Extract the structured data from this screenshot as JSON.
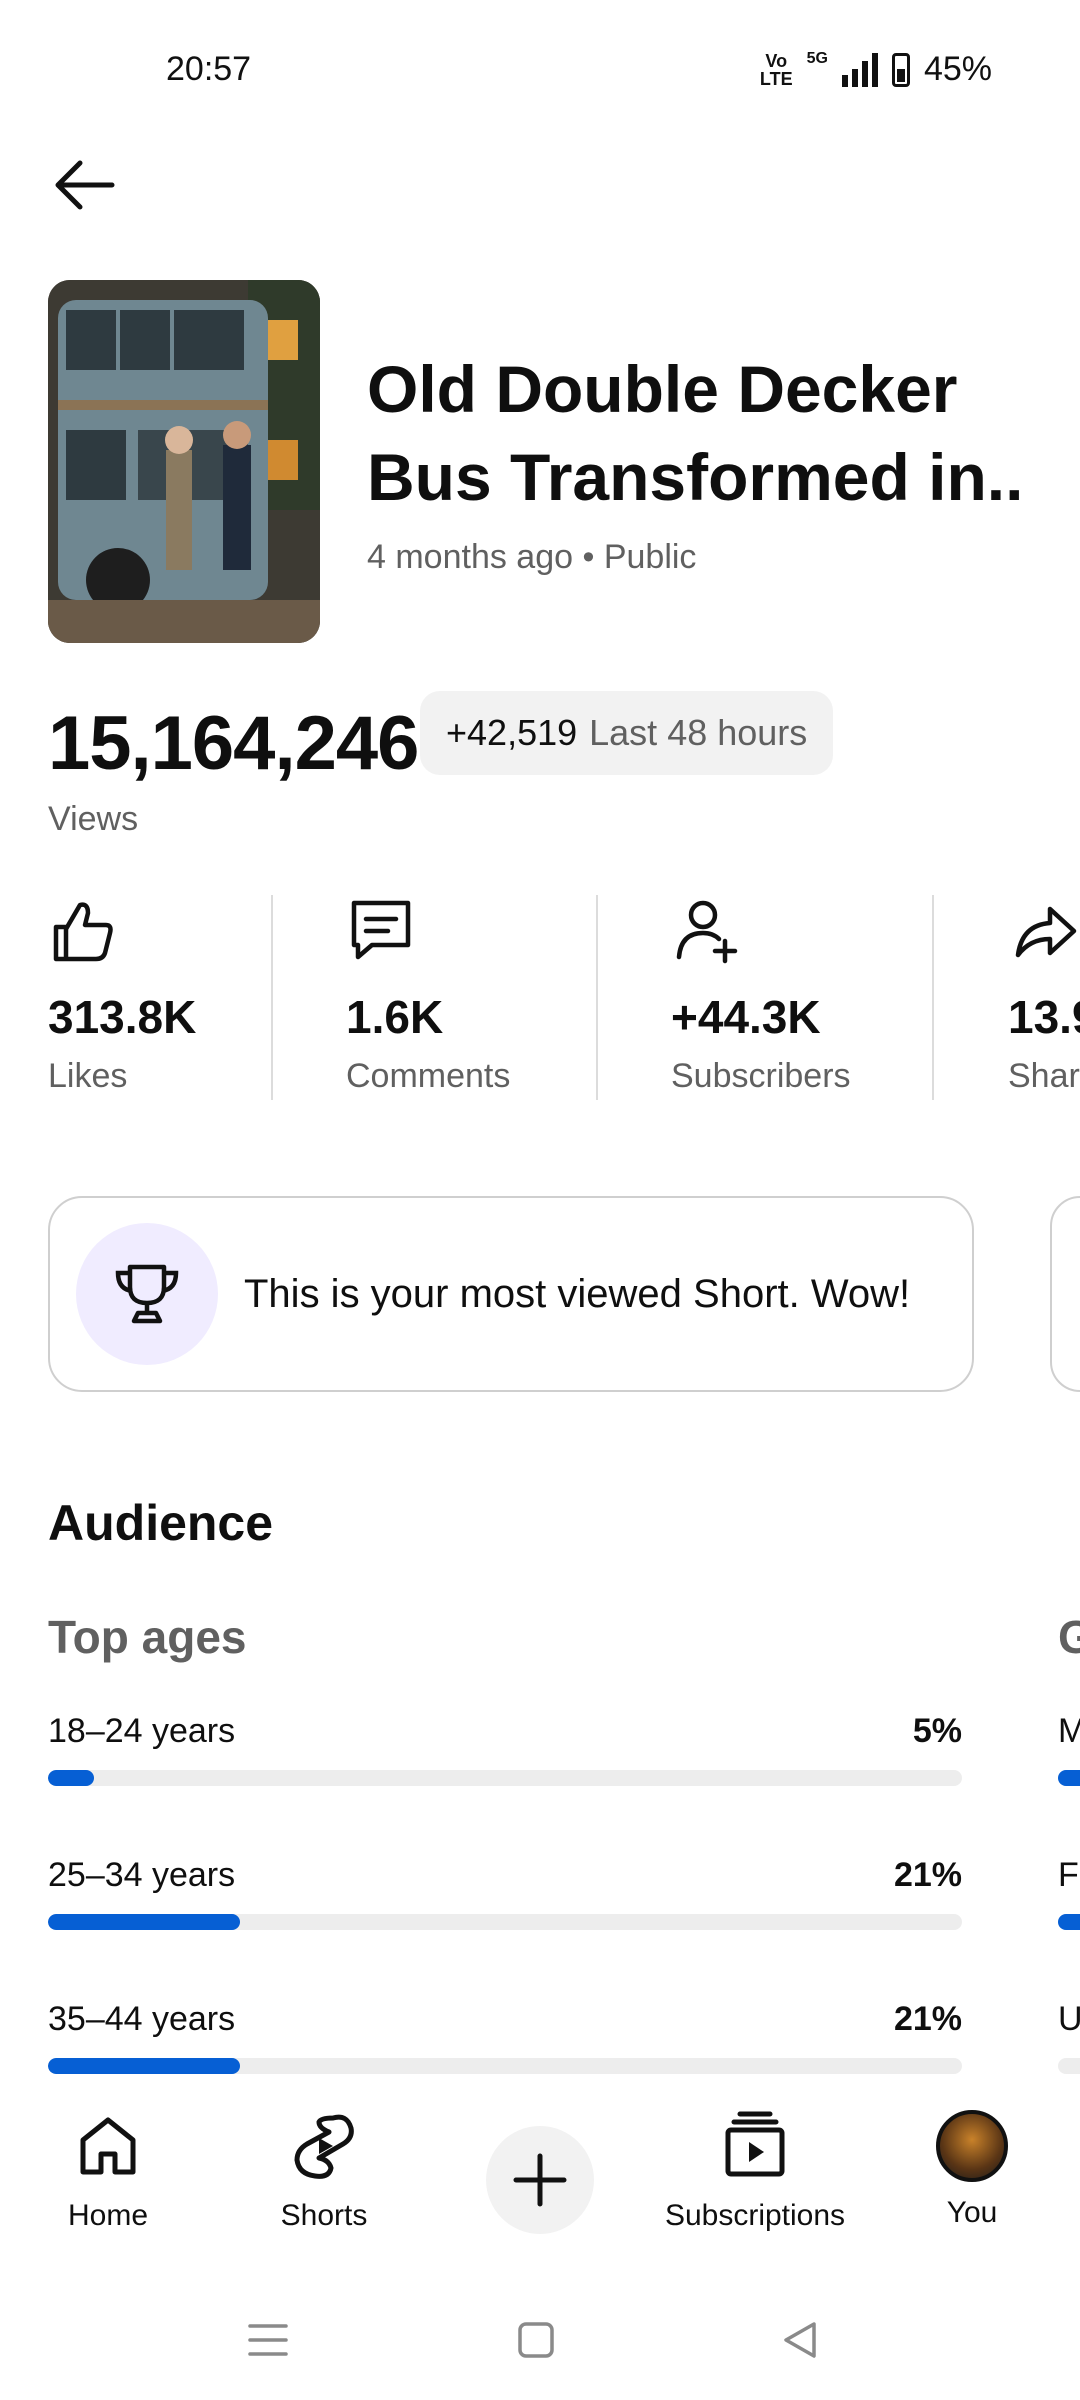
{
  "status": {
    "time": "20:57",
    "volte": "Vo LTE",
    "network": "5G",
    "battery": "45%"
  },
  "video": {
    "title": "Old Double Decker Bus Transformed in..",
    "meta": "4 months ago • Public"
  },
  "views": {
    "count": "15,164,246",
    "delta": "+42,519",
    "period": "Last 48 hours",
    "label": "Views"
  },
  "metrics": [
    {
      "value": "313.8K",
      "label": "Likes",
      "icon": "thumb-up-icon"
    },
    {
      "value": "1.6K",
      "label": "Comments",
      "icon": "comment-icon"
    },
    {
      "value": "+44.3K",
      "label": "Subscribers",
      "icon": "person-add-icon"
    },
    {
      "value": "13.9",
      "label": "Shar",
      "icon": "share-icon"
    }
  ],
  "highlight": {
    "text": "This is your most viewed Short. Wow!",
    "icon": "trophy-icon"
  },
  "audience": {
    "heading": "Audience",
    "top_ages_label": "Top ages",
    "peek_heading": "G",
    "ages": [
      {
        "label": "18–24 years",
        "pct": "5%",
        "fill": 0.05
      },
      {
        "label": "25–34 years",
        "pct": "21%",
        "fill": 0.21
      },
      {
        "label": "35–44 years",
        "pct": "21%",
        "fill": 0.21
      }
    ],
    "peek_rows": [
      "M",
      "F",
      "U"
    ]
  },
  "nav": [
    {
      "label": "Home",
      "icon": "home-icon"
    },
    {
      "label": "Shorts",
      "icon": "shorts-icon"
    },
    {
      "label": "",
      "icon": "create-icon"
    },
    {
      "label": "Subscriptions",
      "icon": "subscriptions-icon"
    },
    {
      "label": "You",
      "icon": "avatar"
    }
  ],
  "colors": {
    "accent": "#065fd4",
    "muted": "#606060",
    "track": "#ededed"
  }
}
